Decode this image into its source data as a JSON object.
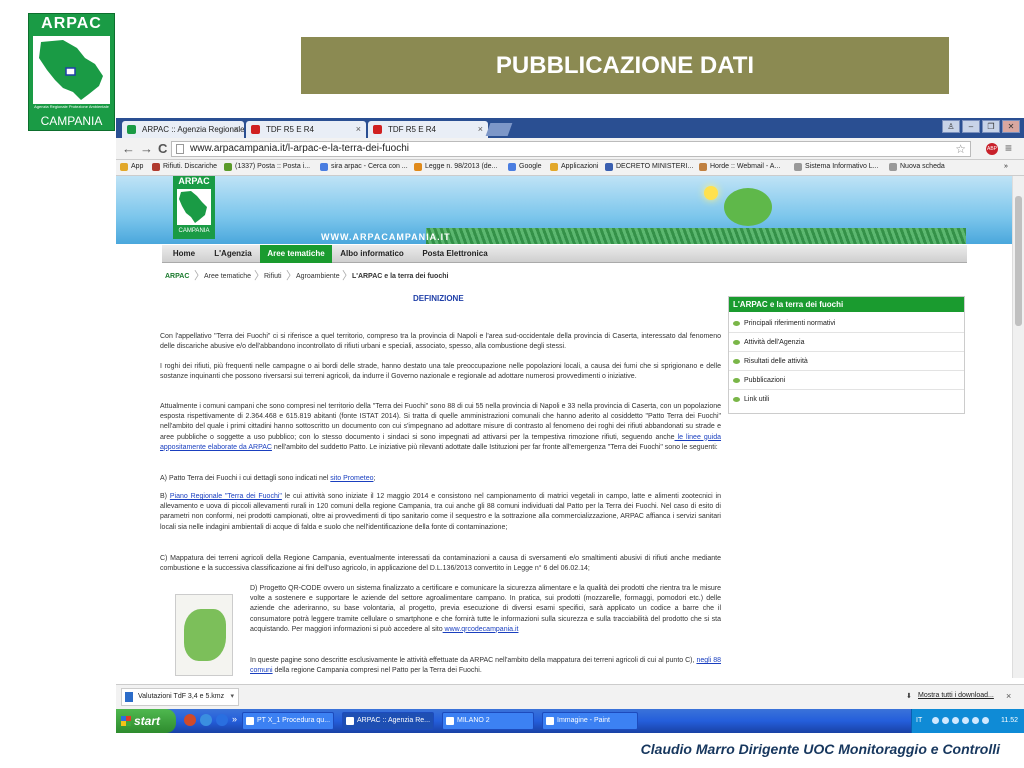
{
  "slide": {
    "logo_top": "ARPAC",
    "logo_sub": "Agenzia Regionale Protezione Ambientale",
    "logo_bottom": "CAMPANIA",
    "title": "PUBBLICAZIONE DATI",
    "footer": "Claudio Marro Dirigente UOC Monitoraggio e Controlli"
  },
  "browser": {
    "tabs": [
      {
        "label": "ARPAC :: Agenzia Regionale",
        "close": "×"
      },
      {
        "label": "TDF R5 E R4",
        "close": "×"
      },
      {
        "label": "TDF R5 E R4",
        "close": "×"
      }
    ],
    "window_controls": {
      "user": "♙",
      "minimize": "–",
      "maximize": "❐",
      "close": "✕"
    },
    "nav": {
      "back": "←",
      "forward": "→",
      "reload": "C"
    },
    "url": "www.arpacampania.it/l-arpac-e-la-terra-dei-fuochi",
    "star": "☆",
    "abp": "ABP",
    "menu": "≡",
    "bookmarks": [
      {
        "label": "App",
        "color": "#e2a82a"
      },
      {
        "label": "Rifiuti. Discariche",
        "color": "#b03a2e"
      },
      {
        "label": "(1337) Posta :: Posta i...",
        "color": "#5b9b2a"
      },
      {
        "label": "sira arpac - Cerca con ...",
        "color": "#4a7de0"
      },
      {
        "label": "Legge n. 98/2013 (de...",
        "color": "#e08a1a"
      },
      {
        "label": "Google",
        "color": "#4a7de0"
      },
      {
        "label": "Applicazioni",
        "color": "#e2a82a"
      },
      {
        "label": "DECRETO MINISTERI...",
        "color": "#3a5fb0"
      },
      {
        "label": "Horde :: Webmail - A...",
        "color": "#c08040"
      },
      {
        "label": "Sistema Informativo L...",
        "color": "#999999"
      },
      {
        "label": "Nuova scheda",
        "color": "#999999"
      }
    ],
    "more_bookmarks": "»"
  },
  "site": {
    "logo_top": "ARPAC",
    "logo_bottom": "CAMPANIA",
    "url_banner": "WWW.ARPACAMPANIA.IT",
    "nav": [
      "Home",
      "L'Agenzia",
      "Aree tematiche",
      "Albo informatico",
      "Posta Elettronica"
    ],
    "breadcrumbs": [
      "ARPAC",
      "Aree tematiche",
      "Rifiuti",
      "Agroambiente",
      "L'ARPAC e la terra dei fuochi"
    ],
    "content_title": "DEFINIZIONE",
    "paragraphs": {
      "p1": "Con l'appellativo \"Terra dei Fuochi\" ci si riferisce a quel territorio, compreso tra la provincia di Napoli e l'area sud-occidentale della provincia di Caserta, interessato dal fenomeno delle discariche abusive e/o dell'abbandono incontrollato di rifiuti urbani e speciali, associato, spesso, alla combustione degli stessi.",
      "p2": "I roghi dei rifiuti, più frequenti nelle campagne o ai bordi delle strade, hanno destato una tale preoccupazione nelle popolazioni locali, a causa dei fumi che si sprigionano e delle sostanze inquinanti che possono riversarsi sui terreni agricoli, da indurre il Governo nazionale e regionale ad adottare numerosi provvedimenti o iniziative.",
      "p3a": "Attualmente i comuni campani che sono compresi nel territorio della \"Terra dei Fuochi\" sono 88 di cui 55 nella provincia di Napoli e 33 nella provincia di Caserta, con un popolazione esposta rispettivamente di 2.364.468 e 615.819 abitanti (fonte ISTAT 2014). Si tratta di quelle amministrazioni comunali che hanno aderito al cosiddetto \"Patto Terra dei Fuochi\" nell'ambito del quale i primi cittadini hanno sottoscritto un documento con cui s'impegnano ad adottare misure di contrasto al fenomeno dei roghi dei rifiuti abbandonati su strade e aree pubbliche o soggette a uso pubblico; con lo stesso documento i sindaci si sono impegnati ad attivarsi per la tempestiva rimozione rifiuti, seguendo anche",
      "p3_link": " le linee guida appositamente elaborate da ARPAC",
      "p3b": " nell'ambito del suddetto Patto. Le iniziative più rilevanti adottate dalle Istituzioni per far fronte all'emergenza \"Terra dei Fuochi\" sono le seguenti:",
      "pa": "A) Patto Terra dei Fuochi  i cui dettagli sono indicati nel ",
      "pa_link": " sito Prometeo",
      "pa_end": ";",
      "pb_start": "B) ",
      "pb_link": "Piano Regionale \"Terra dei Fuochi\"",
      "pb": " le cui attività sono iniziate il 12 maggio 2014 e consistono nel campionamento di matrici vegetali in campo, latte e alimenti zootecnici in allevamento e uova di piccoli allevamenti rurali in 120 comuni della regione Campania, tra cui anche gli 88 comuni individuati dal Patto per la Terra dei Fuochi. Nel caso di esito di parametri non conformi, nei prodotti campionati, oltre ai provvedimenti di tipo sanitario come il sequestro e la sottrazione alla commercializzazione, ARPAC affianca i servizi sanitari locali sia nelle indagini ambientali di acque di falda e suolo che nell'identificazione della fonte di contaminazione;",
      "pc": "C) Mappatura dei terreni agricoli della Regione Campania, eventualmente interessati da contaminazioni a causa di sversamenti e/o smaltimenti abusivi di rifiuti anche mediante combustione e la successiva classificazione ai fini dell'uso agricolo, in applicazione del D.L.136/2013 convertito in Legge n° 6 del 06.02.14;",
      "pd": "D) Progetto QR-CODE ovvero un sistema finalizzato a certificare e comunicare la sicurezza alimentare e la qualità dei prodotti che rientra tra le misure volte a sostenere e supportare le aziende del settore agroalimentare campano. In pratica, sui prodotti (mozzarelle, formaggi, pomodori etc.) delle aziende che aderiranno, su base volontaria, al progetto, previa esecuzione di diversi esami specifici, sarà applicato un codice a barre che il consumatore potrà leggere tramite cellulare o smartphone e che fornirà tutte le informazioni sulla sicurezza e sulla tracciabilità del prodotto che si sta acquistando. Per maggiori informazioni si può accedere al sito",
      "pd_link": " www.qrcodecampania.it",
      "pe": "In queste pagine sono descritte esclusivamente le attività effettuate da ARPAC nell'ambito della mappatura dei terreni agricoli di cui al punto C), ",
      "pe_link": "negli 88 comuni",
      "pe_end": " della regione Campania compresi nel Patto per la Terra dei Fuochi."
    },
    "sidebar": {
      "heading": "L'ARPAC e la terra dei fuochi",
      "items": [
        "Principali riferimenti normativi",
        "Attività dell'Agenzia",
        "Risultati delle attività",
        "Pubblicazioni",
        "Link utili"
      ]
    }
  },
  "downloads": {
    "file": "Valutazioni TdF 3,4 e 5.kmz",
    "arrow": "▾",
    "show_all": "Mostra tutti i download...",
    "close": "×"
  },
  "taskbar": {
    "start": "start",
    "buttons": [
      "PT X_1 Procedura qu...",
      "ARPAC :: Agenzia Re...",
      "MILANO 2",
      "Immagine - Paint"
    ],
    "lang": "IT",
    "time": "11.52",
    "expand": "»"
  }
}
